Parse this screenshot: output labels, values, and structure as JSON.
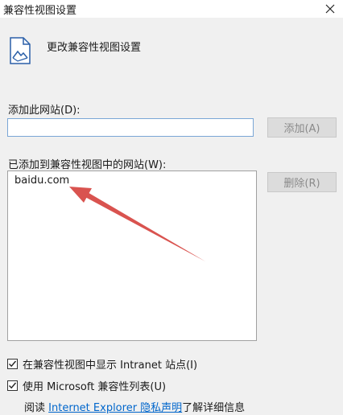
{
  "window": {
    "title": "兼容性视图设置",
    "close_glyph": "✕"
  },
  "header": {
    "title": "更改兼容性视图设置",
    "icon": "document-picture-icon"
  },
  "add_site": {
    "label": "添加此网站(D):",
    "value": "",
    "button_label": "添加(A)"
  },
  "site_list": {
    "label": "已添加到兼容性视图中的网站(W):",
    "items": [
      "baidu.com"
    ],
    "remove_label": "删除(R)"
  },
  "options": {
    "intranet": {
      "label": "在兼容性视图中显示 Intranet 站点(I)",
      "checked": true
    },
    "ms_list": {
      "label": "使用 Microsoft 兼容性列表(U)",
      "checked": true
    }
  },
  "footer": {
    "prefix": "阅读",
    "link_text": "Internet Explorer 隐私声明",
    "suffix": "了解详细信息"
  },
  "annotation": {
    "color": "#d9534f"
  }
}
